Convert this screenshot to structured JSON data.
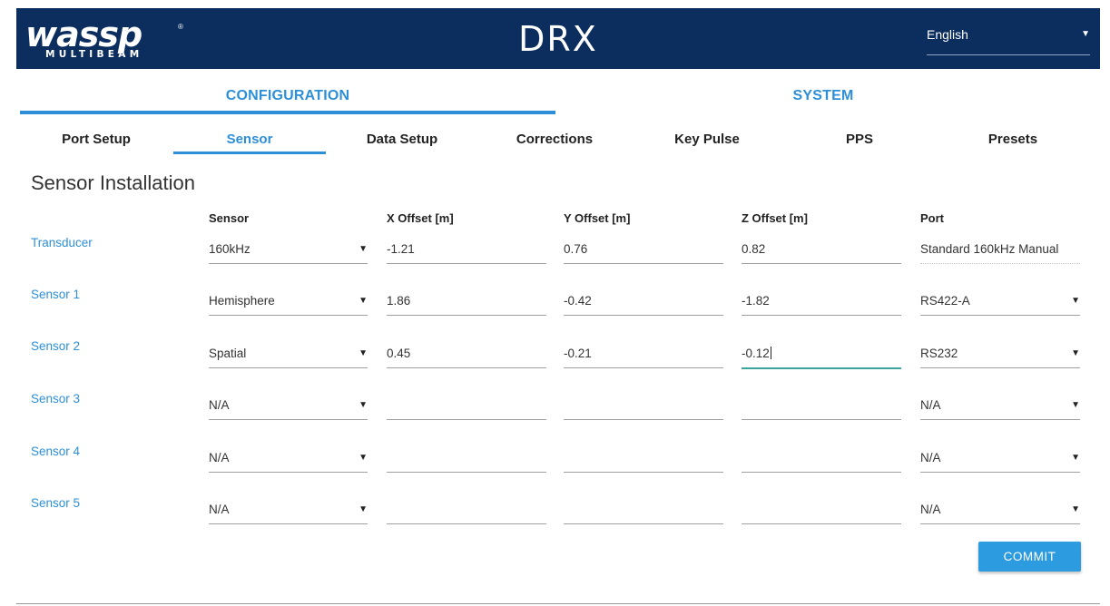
{
  "header": {
    "logo_word": "wassp",
    "logo_sub": "MULTIBEAM",
    "logo_reg": "®",
    "product": "DRX",
    "language": "English",
    "language_caret_icon": "dropdown-caret-icon"
  },
  "main_tabs": [
    {
      "label": "CONFIGURATION",
      "active": true
    },
    {
      "label": "SYSTEM",
      "active": false
    }
  ],
  "sub_tabs": [
    {
      "label": "Port Setup",
      "active": false
    },
    {
      "label": "Sensor",
      "active": true
    },
    {
      "label": "Data Setup",
      "active": false
    },
    {
      "label": "Corrections",
      "active": false
    },
    {
      "label": "Key Pulse",
      "active": false
    },
    {
      "label": "PPS",
      "active": false
    },
    {
      "label": "Presets",
      "active": false
    }
  ],
  "section_title": "Sensor Installation",
  "columns": {
    "sensor": "Sensor",
    "x": "X Offset [m]",
    "y": "Y Offset [m]",
    "z": "Z Offset [m]",
    "port": "Port"
  },
  "rows": [
    {
      "label": "Transducer",
      "sensor": "160kHz",
      "x": "-1.21",
      "y": "0.76",
      "z": "0.82",
      "port": "Standard 160kHz Manual"
    },
    {
      "label": "Sensor 1",
      "sensor": "Hemisphere",
      "x": "1.86",
      "y": "-0.42",
      "z": "-1.82",
      "port": "RS422-A"
    },
    {
      "label": "Sensor 2",
      "sensor": "Spatial",
      "x": "0.45",
      "y": "-0.21",
      "z": "-0.12",
      "port": "RS232"
    },
    {
      "label": "Sensor 3",
      "sensor": "N/A",
      "x": "",
      "y": "",
      "z": "",
      "port": "N/A"
    },
    {
      "label": "Sensor 4",
      "sensor": "N/A",
      "x": "",
      "y": "",
      "z": "",
      "port": "N/A"
    },
    {
      "label": "Sensor 5",
      "sensor": "N/A",
      "x": "",
      "y": "",
      "z": "",
      "port": "N/A"
    }
  ],
  "caret_glyph": "▼",
  "commit_label": "COMMIT",
  "colors": {
    "header_bg": "#0b2e5f",
    "accent": "#2d8fd8",
    "focus_underline": "#3aa69b",
    "button": "#2d9be0"
  }
}
